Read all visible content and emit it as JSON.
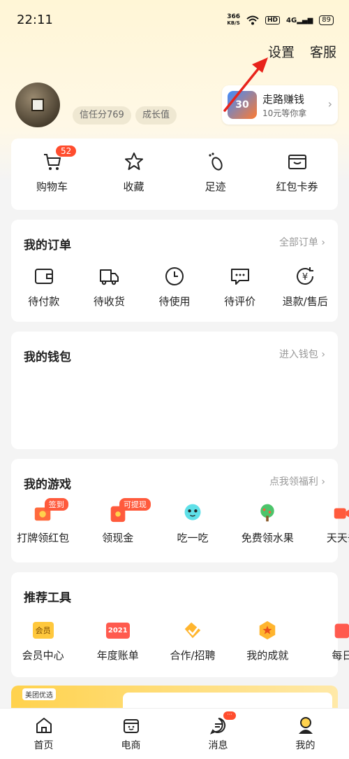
{
  "status_bar": {
    "time": "22:11",
    "net_speed": "366",
    "net_unit": "KB/S",
    "hd": "HD",
    "signal": "4G",
    "battery": "89"
  },
  "top_nav": {
    "settings": "设置",
    "service": "客服"
  },
  "profile": {
    "credit": "信任分769",
    "growth": "成长值"
  },
  "walk_card": {
    "badge": "30",
    "title": "走路赚钱",
    "subtitle": "10元等你拿"
  },
  "quick": [
    {
      "label": "购物车",
      "icon": "cart-icon",
      "badge": "52"
    },
    {
      "label": "收藏",
      "icon": "star-icon"
    },
    {
      "label": "足迹",
      "icon": "footprint-icon"
    },
    {
      "label": "红包卡券",
      "icon": "wallet-card-icon"
    }
  ],
  "orders": {
    "title": "我的订单",
    "link": "全部订单",
    "items": [
      {
        "label": "待付款",
        "icon": "wallet-icon"
      },
      {
        "label": "待收货",
        "icon": "truck-icon"
      },
      {
        "label": "待使用",
        "icon": "clock-icon"
      },
      {
        "label": "待评价",
        "icon": "comment-icon"
      },
      {
        "label": "退款/售后",
        "icon": "refund-icon"
      }
    ]
  },
  "wallet": {
    "title": "我的钱包",
    "link": "进入钱包"
  },
  "games": {
    "title": "我的游戏",
    "link": "点我领福利",
    "items": [
      {
        "label": "打牌领红包",
        "tag": "签到"
      },
      {
        "label": "领现金",
        "tag": "可提现"
      },
      {
        "label": "吃一吃"
      },
      {
        "label": "免费领水果"
      },
      {
        "label": "天天去"
      }
    ]
  },
  "tools": {
    "title": "推荐工具",
    "items": [
      {
        "label": "会员中心",
        "icon_text": "会员"
      },
      {
        "label": "年度账单",
        "icon_text": "2021"
      },
      {
        "label": "合作/招聘"
      },
      {
        "label": "我的成就"
      },
      {
        "label": "每日"
      }
    ]
  },
  "banner": {
    "tag": "美团优选"
  },
  "tabbar": [
    {
      "label": "首页",
      "icon": "home-icon"
    },
    {
      "label": "电商",
      "icon": "shop-icon"
    },
    {
      "label": "消息",
      "icon": "message-icon",
      "badge": "···"
    },
    {
      "label": "我的",
      "icon": "profile-icon"
    }
  ],
  "colors": {
    "accent_red": "#ff4d2e",
    "arrow_red": "#e8231b",
    "header_bg": "#fff6d6"
  }
}
